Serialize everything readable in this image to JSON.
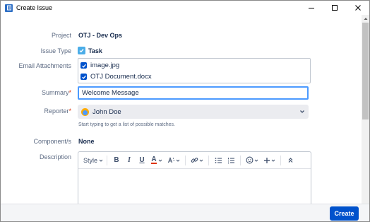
{
  "window": {
    "title": "Create Issue",
    "controls": [
      "minimize",
      "maximize",
      "close"
    ]
  },
  "form": {
    "project": {
      "label": "Project",
      "value": "OTJ - Dev Ops"
    },
    "issue_type": {
      "label": "Issue Type",
      "value": "Task",
      "icon": "task-checkbox-icon"
    },
    "email_attachments": {
      "label": "Email Attachments",
      "items": [
        {
          "name": "image.jpg",
          "checked": true
        },
        {
          "name": "OTJ Document.docx",
          "checked": true
        }
      ]
    },
    "summary": {
      "label": "Summary",
      "required_mark": "*",
      "value": "Welcome Message"
    },
    "reporter": {
      "label": "Reporter",
      "required_mark": "*",
      "value": "John Doe",
      "hint": "Start typing to get a list of possible matches."
    },
    "components": {
      "label": "Component/s",
      "value": "None"
    },
    "description": {
      "label": "Description",
      "toolbar": {
        "style_label": "Style",
        "bold": "B",
        "italic": "I",
        "underline": "U",
        "text_color": "A"
      }
    }
  },
  "footer": {
    "create_label": "Create"
  },
  "colors": {
    "accent": "#0052cc",
    "focus_border": "#4c9aff",
    "required": "#de350b",
    "label": "#5e6c84",
    "text": "#172b4d"
  }
}
